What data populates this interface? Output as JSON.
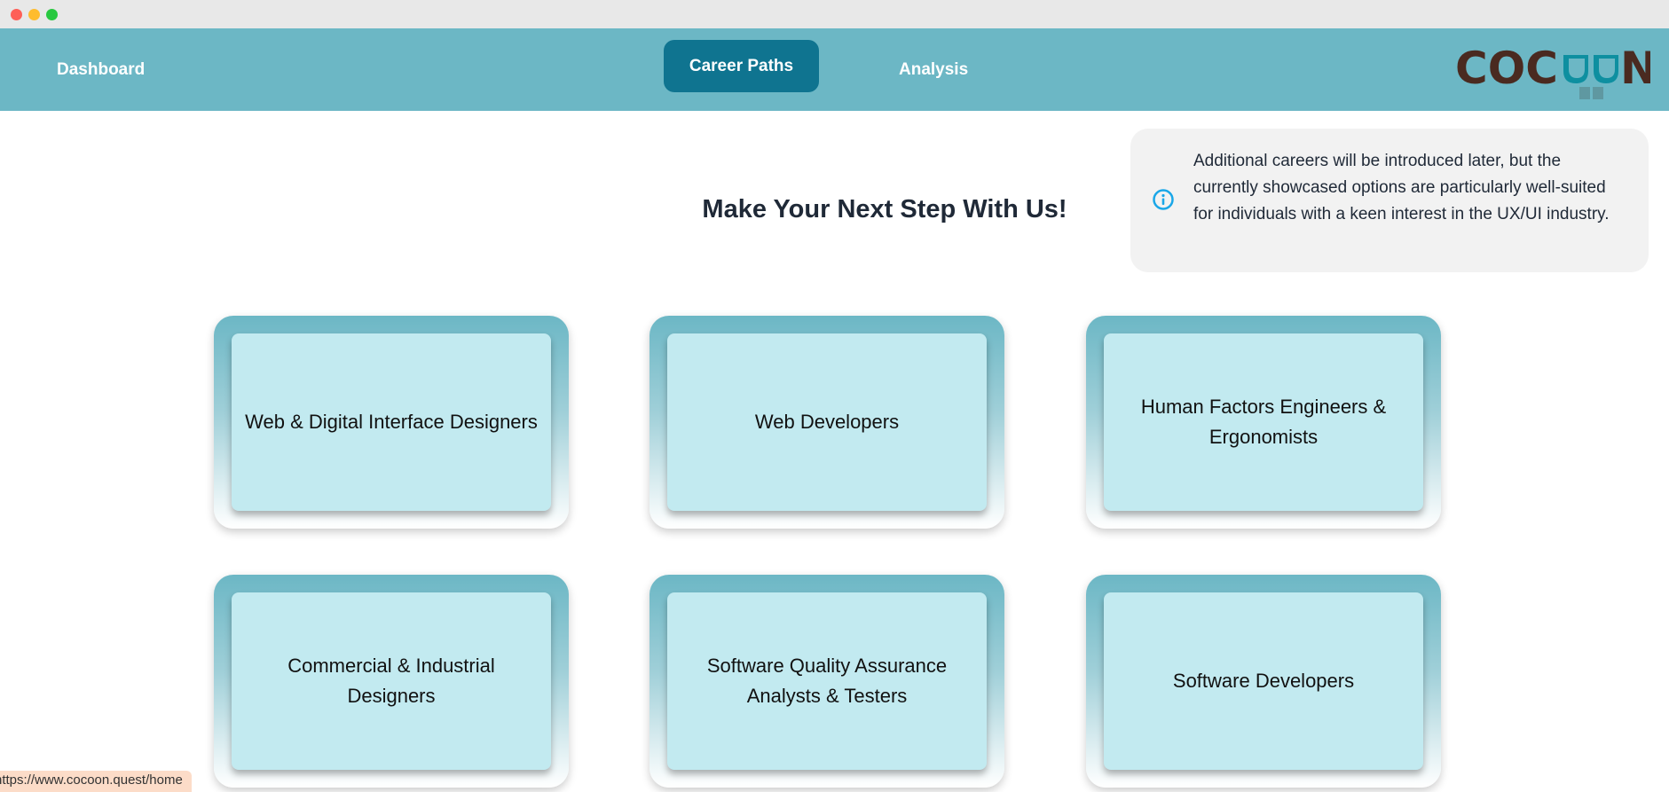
{
  "nav": {
    "items": [
      {
        "label": "Dashboard"
      },
      {
        "label": "Career Paths",
        "active": true
      },
      {
        "label": "Analysis"
      }
    ],
    "logo_text": "COCOON",
    "accent": "#0f7490",
    "bar_color": "#6cb7c5"
  },
  "main": {
    "heading": "Make Your Next Step With Us!",
    "info": {
      "icon": "info-icon",
      "text": "Additional careers will be introduced later, but the currently showcased options are particularly well-suited for individuals with a keen interest in the UX/UI industry."
    },
    "cards": [
      {
        "label": "Web & Digital Interface Designers"
      },
      {
        "label": "Web Developers"
      },
      {
        "label": "Human Factors Engineers & Ergonomists"
      },
      {
        "label": "Commercial & Industrial Designers"
      },
      {
        "label": "Software Quality Assurance Analysts & Testers"
      },
      {
        "label": "Software Developers"
      }
    ]
  },
  "status_bar": {
    "url": "https://www.cocoon.quest/home"
  }
}
